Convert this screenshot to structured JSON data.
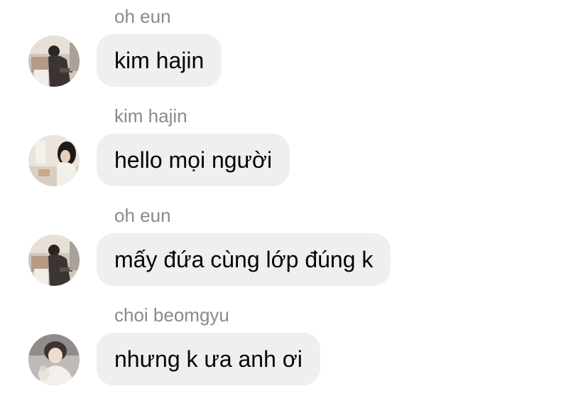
{
  "messages": [
    {
      "sender": "oh eun",
      "text": "kim hajin",
      "avatar_icon": "user-avatar-photo-oh-eun"
    },
    {
      "sender": "kim hajin",
      "text": "hello mọi người",
      "avatar_icon": "user-avatar-photo-kim-hajin"
    },
    {
      "sender": "oh eun",
      "text": "mấy đứa cùng lớp đúng k",
      "avatar_icon": "user-avatar-photo-oh-eun"
    },
    {
      "sender": "choi beomgyu",
      "text": "nhưng k ưa anh ơi",
      "avatar_icon": "user-avatar-photo-choi-beomgyu"
    }
  ],
  "colors": {
    "bubble_background": "#efeff0",
    "sender_name": "#8a8a8e",
    "message_text": "#050505"
  }
}
